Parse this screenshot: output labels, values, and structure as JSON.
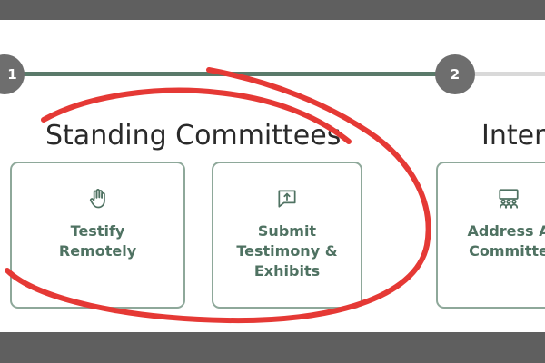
{
  "steps": [
    {
      "number": "1"
    },
    {
      "number": "2"
    }
  ],
  "sections": {
    "standing": {
      "heading": "Standing Committees"
    },
    "interim": {
      "heading": "Interi"
    }
  },
  "cards": [
    {
      "label": "Testify\nRemotely",
      "icon": "raised-hand-icon"
    },
    {
      "label": "Submit\nTestimony &\nExhibits",
      "icon": "upload-message-icon"
    },
    {
      "label": "Address A\nCommitte",
      "icon": "group-meeting-icon"
    }
  ],
  "colors": {
    "accent": "#4f7262",
    "card_border": "#8ea89a",
    "progress_done": "#5a7a6a",
    "progress_pending": "#d9d9d9",
    "step_circle": "#6e6e6e",
    "annotation": "#e53935",
    "frame": "#5f5f5f"
  }
}
